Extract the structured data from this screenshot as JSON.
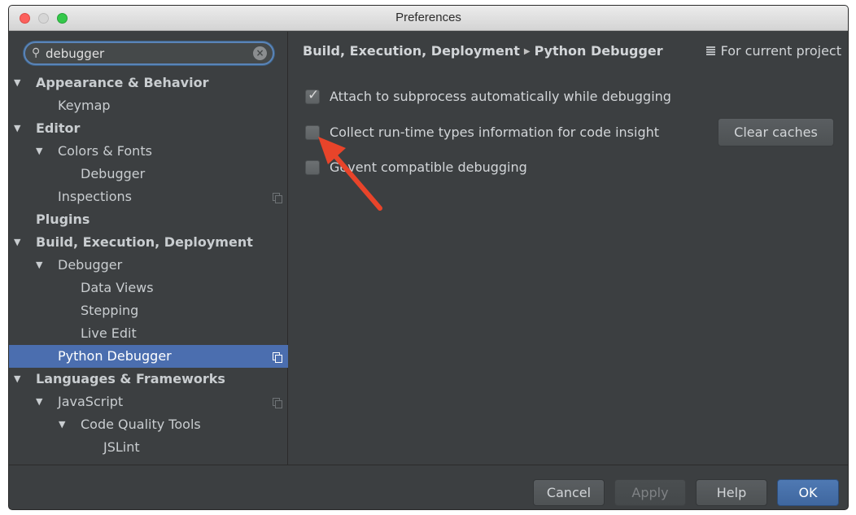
{
  "window": {
    "title": "Preferences"
  },
  "search": {
    "value": "debugger",
    "placeholder": ""
  },
  "tree": [
    {
      "label": "Appearance & Behavior",
      "bold": true,
      "arrow": true,
      "level": 0
    },
    {
      "label": "Keymap",
      "bold": false,
      "arrow": false,
      "level": 1
    },
    {
      "label": "Editor",
      "bold": true,
      "arrow": true,
      "level": 0
    },
    {
      "label": "Colors & Fonts",
      "bold": false,
      "arrow": true,
      "level": 1
    },
    {
      "label": "Debugger",
      "bold": false,
      "arrow": false,
      "level": 2
    },
    {
      "label": "Inspections",
      "bold": false,
      "arrow": false,
      "level": 1,
      "copy_icon": true
    },
    {
      "label": "Plugins",
      "bold": true,
      "arrow": false,
      "level": 0
    },
    {
      "label": "Build, Execution, Deployment",
      "bold": true,
      "arrow": true,
      "level": 0
    },
    {
      "label": "Debugger",
      "bold": false,
      "arrow": true,
      "level": 1
    },
    {
      "label": "Data Views",
      "bold": false,
      "arrow": false,
      "level": 2
    },
    {
      "label": "Stepping",
      "bold": false,
      "arrow": false,
      "level": 2
    },
    {
      "label": "Live Edit",
      "bold": false,
      "arrow": false,
      "level": 2
    },
    {
      "label": "Python Debugger",
      "bold": false,
      "arrow": false,
      "level": 1,
      "selected": true,
      "copy_icon": true
    },
    {
      "label": "Languages & Frameworks",
      "bold": true,
      "arrow": true,
      "level": 0
    },
    {
      "label": "JavaScript",
      "bold": false,
      "arrow": true,
      "level": 1,
      "copy_icon": true
    },
    {
      "label": "Code Quality Tools",
      "bold": false,
      "arrow": true,
      "level": 2
    },
    {
      "label": "JSLint",
      "bold": false,
      "arrow": false,
      "level": 3
    }
  ],
  "breadcrumb": {
    "parent": "Build, Execution, Deployment",
    "current": "Python Debugger"
  },
  "scope": {
    "label": "For current project"
  },
  "options": [
    {
      "label": "Attach to subprocess automatically while debugging",
      "checked": true
    },
    {
      "label": "Collect run-time types information for code insight",
      "checked": false
    },
    {
      "label": "Gevent compatible debugging",
      "checked": false
    }
  ],
  "clear_caches": {
    "label": "Clear caches"
  },
  "footer": {
    "cancel": "Cancel",
    "apply": "Apply",
    "help": "Help",
    "ok": "OK"
  },
  "colors": {
    "background": "#3c3f41",
    "selection": "#4b6eaf",
    "annotation_arrow": "#e8442a"
  }
}
